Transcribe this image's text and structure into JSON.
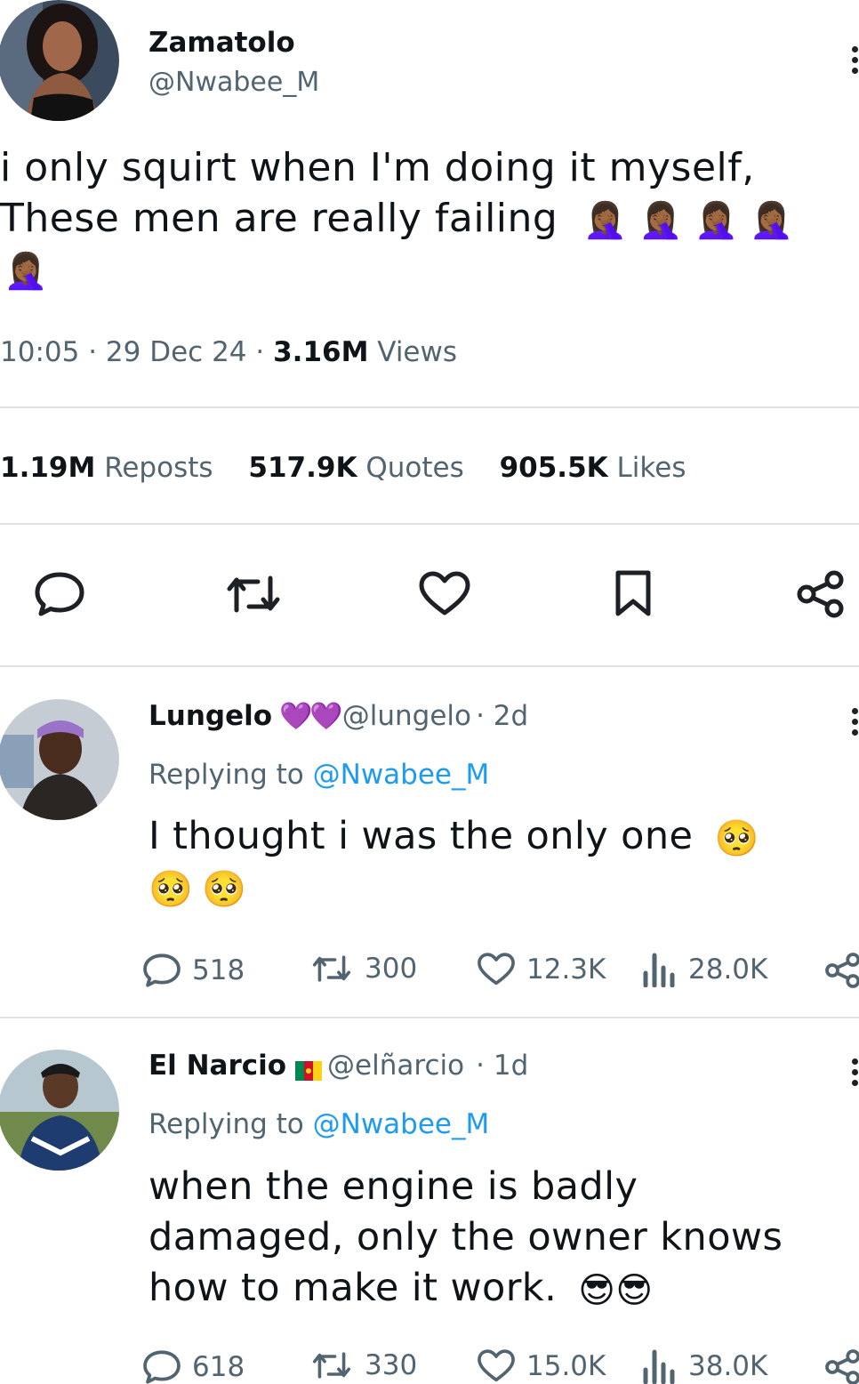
{
  "tweet": {
    "author_name": "Zamatolo",
    "author_handle": "@Nwabee_M",
    "text_line1": "i only squirt when I'm doing it myself,",
    "text_line2": "These men are really failing",
    "emoji": "🤦🏾‍♀️",
    "time": "10:05",
    "date": "29 Dec 24",
    "views_count": "3.16M",
    "views_label": "Views",
    "reposts_count": "1.19M",
    "reposts_label": "Reposts",
    "quotes_count": "517.9K",
    "quotes_label": "Quotes",
    "likes_count": "905.5K",
    "likes_label": "Likes",
    "separator": "·"
  },
  "replies": [
    {
      "name": "Lungelo",
      "badge": "💜💜",
      "handle": "@lungelo",
      "age": "· 2d",
      "replying_label": "Replying to",
      "replying_to": "@Nwabee_M",
      "text": "I thought i was the only one",
      "emoji": "🥺",
      "replies": "518",
      "reposts": "300",
      "likes": "12.3K",
      "views": "28.0K"
    },
    {
      "name": "El Narcio",
      "handle": "@elñarcio",
      "age": "· 1d",
      "replying_label": "Replying to",
      "replying_to": "@Nwabee_M",
      "text_line1": "when the engine is badly",
      "text_line2": "damaged, only the owner knows",
      "text_line3": "how to make it work.",
      "emoji": "😎",
      "replies": "618",
      "reposts": "330",
      "likes": "15.0K",
      "views": "38.0K"
    }
  ],
  "colors": {
    "text": "#0f1419",
    "secondary": "#536471",
    "link": "#1d9bf0",
    "divider": "#dfe3e6"
  },
  "icons": [
    "reply-icon",
    "repost-icon",
    "like-icon",
    "bookmark-icon",
    "share-icon",
    "views-icon",
    "more-icon"
  ]
}
